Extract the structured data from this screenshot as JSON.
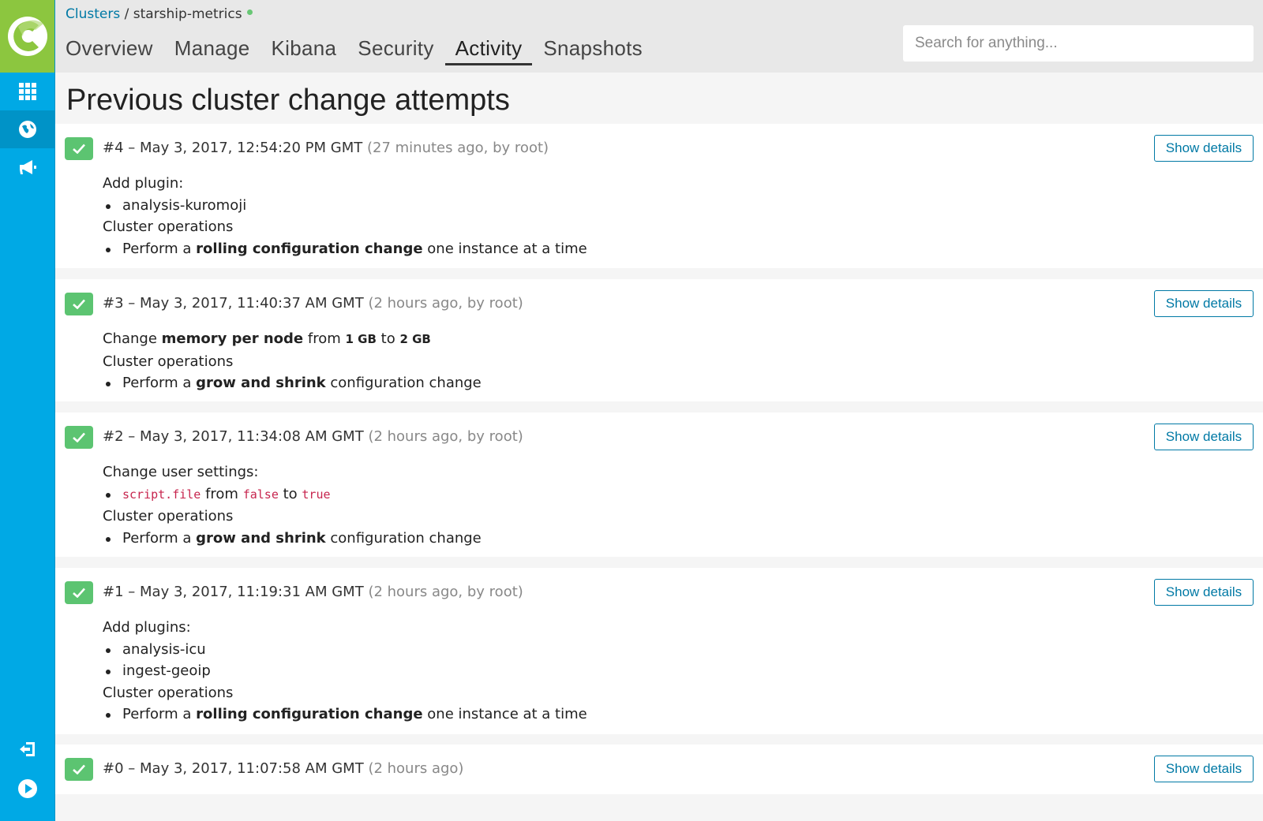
{
  "breadcrumb": {
    "clusters": "Clusters",
    "separator": "/",
    "cluster": "starship-metrics"
  },
  "tabs": [
    "Overview",
    "Manage",
    "Kibana",
    "Security",
    "Activity",
    "Snapshots"
  ],
  "active_tab": "Activity",
  "search": {
    "placeholder": "Search for anything..."
  },
  "page_title": "Previous cluster change attempts",
  "show_details_label": "Show details",
  "cluster_ops_label": "Cluster operations",
  "changes": [
    {
      "id": "#4",
      "dash": "–",
      "time": "May 3, 2017, 12:54:20 PM GMT",
      "meta": "(27 minutes ago, by root)",
      "heading": "Add plugin:",
      "plugins": [
        "analysis-kuromoji"
      ],
      "op": {
        "pre": "Perform a",
        "bold": "rolling configuration change",
        "post": "one instance at a time"
      }
    },
    {
      "id": "#3",
      "dash": "–",
      "time": "May 3, 2017, 11:40:37 AM GMT",
      "meta": "(2 hours ago, by root)",
      "memory": {
        "pre": "Change",
        "bold": "memory per node",
        "from": "from",
        "from_val": "1 GB",
        "to": "to",
        "to_val": "2 GB"
      },
      "op": {
        "pre": "Perform a",
        "bold": "grow and shrink",
        "post": "configuration change"
      }
    },
    {
      "id": "#2",
      "dash": "–",
      "time": "May 3, 2017, 11:34:08 AM GMT",
      "meta": "(2 hours ago, by root)",
      "heading": "Change user settings:",
      "setting": {
        "key": "script.file",
        "from": "from",
        "old": "false",
        "to": "to",
        "new": "true"
      },
      "op": {
        "pre": "Perform a",
        "bold": "grow and shrink",
        "post": "configuration change"
      }
    },
    {
      "id": "#1",
      "dash": "–",
      "time": "May 3, 2017, 11:19:31 AM GMT",
      "meta": "(2 hours ago, by root)",
      "heading": "Add plugins:",
      "plugins": [
        "analysis-icu",
        "ingest-geoip"
      ],
      "op": {
        "pre": "Perform a",
        "bold": "rolling configuration change",
        "post": "one instance at a time"
      }
    },
    {
      "id": "#0",
      "dash": "–",
      "time": "May 3, 2017, 11:07:58 AM GMT",
      "meta": "(2 hours ago)"
    }
  ],
  "colors": {
    "sidebar": "#00a9e5",
    "logo_bg": "#8cc63f",
    "success": "#5cc471",
    "link": "#0079a5",
    "code": "#c7254e"
  },
  "icons": {
    "sidebar_top": [
      "apps-grid-icon",
      "globe-icon",
      "megaphone-icon"
    ],
    "sidebar_bottom": [
      "logout-icon",
      "play-circle-icon"
    ],
    "status": "check-icon"
  }
}
